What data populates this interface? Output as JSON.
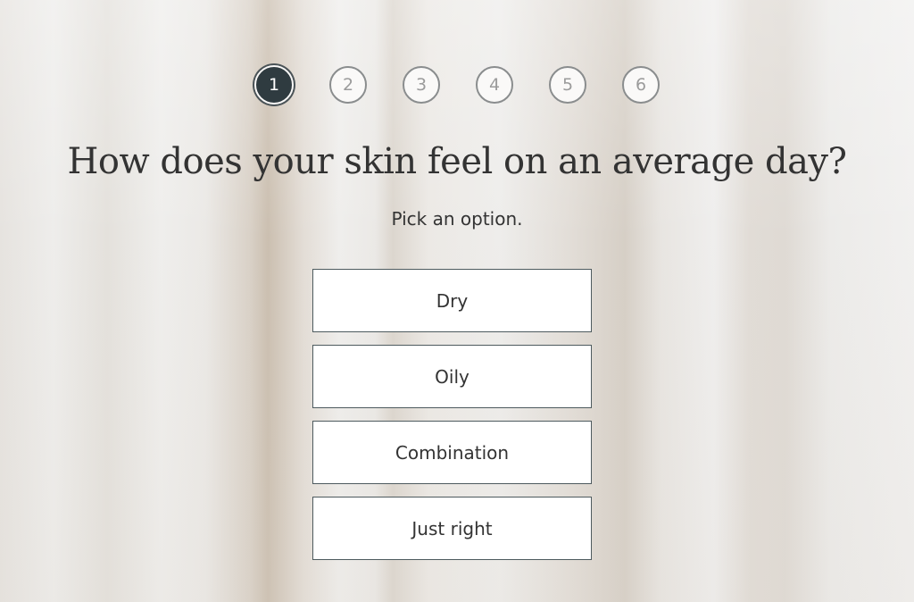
{
  "progress": {
    "current_step": 1,
    "steps": [
      "1",
      "2",
      "3",
      "4",
      "5",
      "6"
    ]
  },
  "question": {
    "title": "How does your skin feel on an average day?",
    "hint": "Pick an option."
  },
  "options": [
    "Dry",
    "Oily",
    "Combination",
    "Just right"
  ],
  "colors": {
    "active_step": "#2f3b40",
    "option_border": "#4d5a5e",
    "text": "#333333"
  }
}
